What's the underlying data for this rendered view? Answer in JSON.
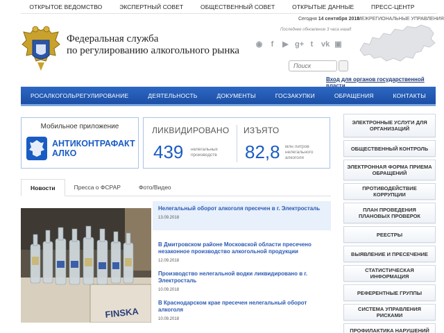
{
  "top_links": [
    "ОТКРЫТОЕ ВЕДОМСТВО",
    "ЭКСПЕРТНЫЙ СОВЕТ",
    "ОБЩЕСТВЕННЫЙ СОВЕТ",
    "ОТКРЫТЫЕ ДАННЫЕ",
    "ПРЕСС-ЦЕНТР"
  ],
  "header": {
    "org_line1": "Федеральная служба",
    "org_line2": "по регулированию алкогольного рынка",
    "date_prefix": "Сегодня",
    "date": "14 сентября 2018",
    "updated": "Последнее обновление 3 часа назад",
    "regional": "МЕЖРЕГИОНАЛЬНЫЕ УПРАВЛЕНИЯ",
    "search_placeholder": "Поиск",
    "gov_link": "Вход для органов государственной власти"
  },
  "socials": [
    "eye-icon",
    "facebook-icon",
    "youtube-icon",
    "googleplus-icon",
    "twitter-icon",
    "vk-icon",
    "instagram-icon"
  ],
  "nav": [
    "РОСАЛКОГОЛЬРЕГУЛИРОВАНИЕ",
    "ДЕЯТЕЛЬНОСТЬ",
    "ДОКУМЕНТЫ",
    "ГОСЗАКУПКИ",
    "ОБРАЩЕНИЯ",
    "КОНТАКТЫ"
  ],
  "app": {
    "title": "Мобильное приложение",
    "name_line1": "АНТИКОНТРАФАКТ",
    "name_line2": "АЛКО"
  },
  "stats": {
    "liquidated_label": "ЛИКВИДИРОВАНО",
    "liquidated_value": "439",
    "liquidated_unit_1": "нелегальных",
    "liquidated_unit_2": "производств",
    "seized_label": "ИЗЪЯТО",
    "seized_value": "82,8",
    "seized_unit_1": "млн литров",
    "seized_unit_2": "нелегального",
    "seized_unit_3": "алкоголя"
  },
  "tabs": [
    "Новости",
    "Пресса о ФСРАР",
    "Фото/Видео"
  ],
  "news": [
    {
      "title": "Нелегальный оборот алкоголя пресечен в г. Электросталь",
      "date": "13.09.2018"
    },
    {
      "title": "В Дмитровском районе Московской области пресечено незаконное производство алкогольной продукции",
      "date": "12.09.2018"
    },
    {
      "title": "Производство нелегальной водки ликвидировано в г. Электросталь",
      "date": "10.09.2018"
    },
    {
      "title": "В Краснодарском крае пресечен нелегальный оборот алкоголя",
      "date": "10.09.2018"
    }
  ],
  "photo_box_text": "FINSKA",
  "sidebar": [
    "ЭЛЕКТРОННЫЕ УСЛУГИ ДЛЯ ОРГАНИЗАЦИЙ",
    "ОБЩЕСТВЕННЫЙ КОНТРОЛЬ",
    "ЭЛЕКТРОННАЯ ФОРМА ПРИЕМА ОБРАЩЕНИЙ",
    "ПРОТИВОДЕЙСТВИЕ КОРРУПЦИИ",
    "ПЛАН ПРОВЕДЕНИЯ ПЛАНОВЫХ ПРОВЕРОК",
    "РЕЕСТРЫ",
    "ВЫЯВЛЕНИЕ И ПРЕСЕЧЕНИЕ",
    "СТАТИСТИЧЕСКАЯ ИНФОРМАЦИЯ",
    "РЕФЕРЕНТНЫЕ ГРУППЫ",
    "СИСТЕМА УПРАВЛЕНИЯ РИСКАМИ",
    "ПРОФИЛАКТИКА НАРУШЕНИЙ ОБЯЗАТЕЛЬНЫХ ТРЕБОВАНИЙ"
  ],
  "colors": {
    "accent": "#1a5cc4",
    "nav_top": "#2d68c4",
    "nav_bottom": "#1c4ea5",
    "link": "#2a5ab3"
  }
}
